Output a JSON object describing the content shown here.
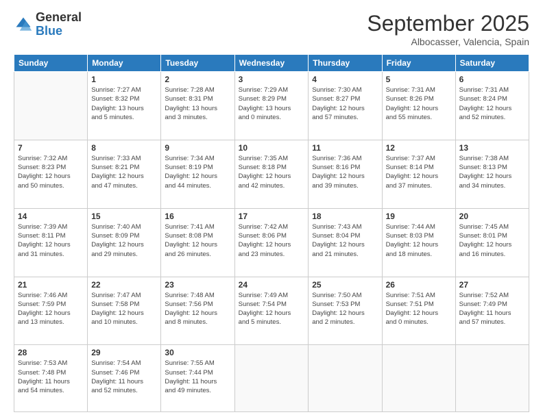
{
  "logo": {
    "general": "General",
    "blue": "Blue"
  },
  "header": {
    "month": "September 2025",
    "location": "Albocasser, Valencia, Spain"
  },
  "days_of_week": [
    "Sunday",
    "Monday",
    "Tuesday",
    "Wednesday",
    "Thursday",
    "Friday",
    "Saturday"
  ],
  "weeks": [
    [
      {
        "day": "",
        "info": ""
      },
      {
        "day": "1",
        "info": "Sunrise: 7:27 AM\nSunset: 8:32 PM\nDaylight: 13 hours\nand 5 minutes."
      },
      {
        "day": "2",
        "info": "Sunrise: 7:28 AM\nSunset: 8:31 PM\nDaylight: 13 hours\nand 3 minutes."
      },
      {
        "day": "3",
        "info": "Sunrise: 7:29 AM\nSunset: 8:29 PM\nDaylight: 13 hours\nand 0 minutes."
      },
      {
        "day": "4",
        "info": "Sunrise: 7:30 AM\nSunset: 8:27 PM\nDaylight: 12 hours\nand 57 minutes."
      },
      {
        "day": "5",
        "info": "Sunrise: 7:31 AM\nSunset: 8:26 PM\nDaylight: 12 hours\nand 55 minutes."
      },
      {
        "day": "6",
        "info": "Sunrise: 7:31 AM\nSunset: 8:24 PM\nDaylight: 12 hours\nand 52 minutes."
      }
    ],
    [
      {
        "day": "7",
        "info": "Sunrise: 7:32 AM\nSunset: 8:23 PM\nDaylight: 12 hours\nand 50 minutes."
      },
      {
        "day": "8",
        "info": "Sunrise: 7:33 AM\nSunset: 8:21 PM\nDaylight: 12 hours\nand 47 minutes."
      },
      {
        "day": "9",
        "info": "Sunrise: 7:34 AM\nSunset: 8:19 PM\nDaylight: 12 hours\nand 44 minutes."
      },
      {
        "day": "10",
        "info": "Sunrise: 7:35 AM\nSunset: 8:18 PM\nDaylight: 12 hours\nand 42 minutes."
      },
      {
        "day": "11",
        "info": "Sunrise: 7:36 AM\nSunset: 8:16 PM\nDaylight: 12 hours\nand 39 minutes."
      },
      {
        "day": "12",
        "info": "Sunrise: 7:37 AM\nSunset: 8:14 PM\nDaylight: 12 hours\nand 37 minutes."
      },
      {
        "day": "13",
        "info": "Sunrise: 7:38 AM\nSunset: 8:13 PM\nDaylight: 12 hours\nand 34 minutes."
      }
    ],
    [
      {
        "day": "14",
        "info": "Sunrise: 7:39 AM\nSunset: 8:11 PM\nDaylight: 12 hours\nand 31 minutes."
      },
      {
        "day": "15",
        "info": "Sunrise: 7:40 AM\nSunset: 8:09 PM\nDaylight: 12 hours\nand 29 minutes."
      },
      {
        "day": "16",
        "info": "Sunrise: 7:41 AM\nSunset: 8:08 PM\nDaylight: 12 hours\nand 26 minutes."
      },
      {
        "day": "17",
        "info": "Sunrise: 7:42 AM\nSunset: 8:06 PM\nDaylight: 12 hours\nand 23 minutes."
      },
      {
        "day": "18",
        "info": "Sunrise: 7:43 AM\nSunset: 8:04 PM\nDaylight: 12 hours\nand 21 minutes."
      },
      {
        "day": "19",
        "info": "Sunrise: 7:44 AM\nSunset: 8:03 PM\nDaylight: 12 hours\nand 18 minutes."
      },
      {
        "day": "20",
        "info": "Sunrise: 7:45 AM\nSunset: 8:01 PM\nDaylight: 12 hours\nand 16 minutes."
      }
    ],
    [
      {
        "day": "21",
        "info": "Sunrise: 7:46 AM\nSunset: 7:59 PM\nDaylight: 12 hours\nand 13 minutes."
      },
      {
        "day": "22",
        "info": "Sunrise: 7:47 AM\nSunset: 7:58 PM\nDaylight: 12 hours\nand 10 minutes."
      },
      {
        "day": "23",
        "info": "Sunrise: 7:48 AM\nSunset: 7:56 PM\nDaylight: 12 hours\nand 8 minutes."
      },
      {
        "day": "24",
        "info": "Sunrise: 7:49 AM\nSunset: 7:54 PM\nDaylight: 12 hours\nand 5 minutes."
      },
      {
        "day": "25",
        "info": "Sunrise: 7:50 AM\nSunset: 7:53 PM\nDaylight: 12 hours\nand 2 minutes."
      },
      {
        "day": "26",
        "info": "Sunrise: 7:51 AM\nSunset: 7:51 PM\nDaylight: 12 hours\nand 0 minutes."
      },
      {
        "day": "27",
        "info": "Sunrise: 7:52 AM\nSunset: 7:49 PM\nDaylight: 11 hours\nand 57 minutes."
      }
    ],
    [
      {
        "day": "28",
        "info": "Sunrise: 7:53 AM\nSunset: 7:48 PM\nDaylight: 11 hours\nand 54 minutes."
      },
      {
        "day": "29",
        "info": "Sunrise: 7:54 AM\nSunset: 7:46 PM\nDaylight: 11 hours\nand 52 minutes."
      },
      {
        "day": "30",
        "info": "Sunrise: 7:55 AM\nSunset: 7:44 PM\nDaylight: 11 hours\nand 49 minutes."
      },
      {
        "day": "",
        "info": ""
      },
      {
        "day": "",
        "info": ""
      },
      {
        "day": "",
        "info": ""
      },
      {
        "day": "",
        "info": ""
      }
    ]
  ]
}
